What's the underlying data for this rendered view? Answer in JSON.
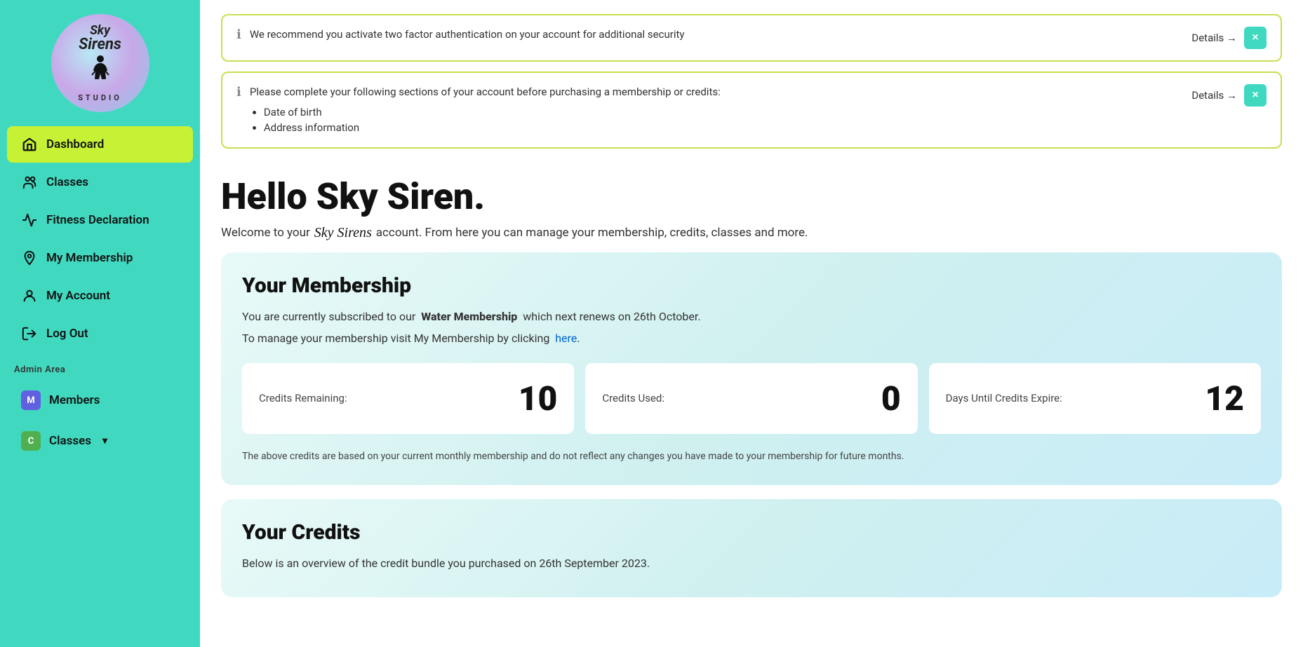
{
  "sidebar": {
    "logo": {
      "text_sky": "Sky",
      "text_siren": "Sirens",
      "studio": "STUDIO",
      "figure_icon": "🧍"
    },
    "nav_items": [
      {
        "id": "dashboard",
        "label": "Dashboard",
        "icon": "🏠",
        "active": true
      },
      {
        "id": "classes",
        "label": "Classes",
        "icon": "👥",
        "active": false
      },
      {
        "id": "fitness-declaration",
        "label": "Fitness Declaration",
        "icon": "📊",
        "active": false
      },
      {
        "id": "my-membership",
        "label": "My Membership",
        "icon": "🎫",
        "active": false
      },
      {
        "id": "my-account",
        "label": "My Account",
        "icon": "👤",
        "active": false
      },
      {
        "id": "log-out",
        "label": "Log Out",
        "icon": "🚪",
        "active": false
      }
    ],
    "admin_area": {
      "label": "Admin Area",
      "items": [
        {
          "id": "members",
          "label": "Members",
          "badge": "M",
          "badge_class": "badge-m"
        },
        {
          "id": "classes-admin",
          "label": "Classes",
          "badge": "C",
          "badge_class": "badge-c",
          "has_chevron": true
        }
      ]
    }
  },
  "alerts": [
    {
      "id": "alert-2fa",
      "message": "We recommend you activate two factor authentication on your account for additional security",
      "details_label": "Details →",
      "close_label": "×"
    },
    {
      "id": "alert-account",
      "message": "Please complete your following sections of your account before purchasing a membership or credits:",
      "list_items": [
        "Date of birth",
        "Address information"
      ],
      "details_label": "Details →",
      "close_label": "×"
    }
  ],
  "greeting": {
    "title": "Hello Sky Siren.",
    "subtitle_before": "Welcome to your",
    "brand": "Sky Sirens",
    "subtitle_after": "account. From here you can manage your membership, credits, classes and more."
  },
  "membership_section": {
    "title": "Your Membership",
    "description_before": "You are currently subscribed to our",
    "membership_name": "Water Membership",
    "description_after": "which next renews on 26th October.",
    "manage_text_before": "To manage your membership visit My Membership by clicking",
    "manage_link_label": "here",
    "manage_text_after": ".",
    "stats": [
      {
        "label": "Credits Remaining:",
        "value": "10"
      },
      {
        "label": "Credits Used:",
        "value": "0"
      },
      {
        "label": "Days Until Credits Expire:",
        "value": "12"
      }
    ],
    "credits_note": "The above credits are based on your current monthly membership and do not reflect any changes you have made to your membership for future months."
  },
  "credits_section": {
    "title": "Your Credits",
    "subtitle": "Below is an overview of the credit bundle you purchased on 26th September 2023."
  },
  "icons": {
    "info": "ℹ",
    "close": "×",
    "home": "⌂",
    "chevron_down": "▾"
  }
}
